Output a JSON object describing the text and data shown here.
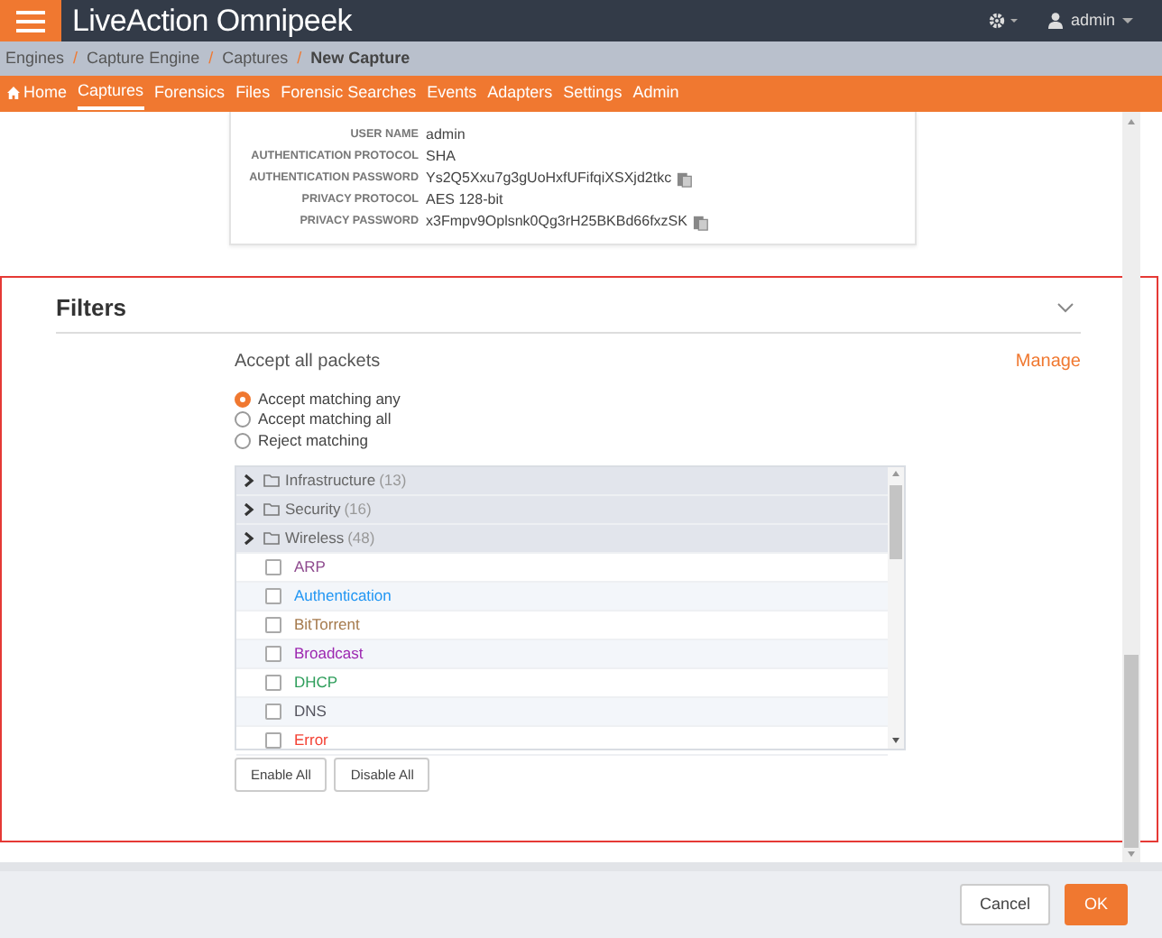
{
  "app": {
    "title": "LiveAction Omnipeek",
    "user": "admin"
  },
  "breadcrumb": [
    {
      "label": "Engines",
      "current": false
    },
    {
      "separator": "/",
      "label": "Capture Engine",
      "current": false
    },
    {
      "separator": "/",
      "label": "Captures",
      "current": false
    },
    {
      "separator": "/",
      "label": "New Capture",
      "current": true
    }
  ],
  "nav": [
    {
      "label": "Home",
      "selected": false,
      "icon": true
    },
    {
      "label": "Captures",
      "selected": true,
      "icon": false
    },
    {
      "label": "Forensics",
      "selected": false,
      "icon": false
    },
    {
      "label": "Files",
      "selected": false,
      "icon": false
    },
    {
      "label": "Forensic Searches",
      "selected": false,
      "icon": false
    },
    {
      "label": "Events",
      "selected": false,
      "icon": false
    },
    {
      "label": "Adapters",
      "selected": false,
      "icon": false
    },
    {
      "label": "Settings",
      "selected": false,
      "icon": false
    },
    {
      "label": "Admin",
      "selected": false,
      "icon": false
    }
  ],
  "snmp": [
    {
      "label": "USER NAME",
      "value": "admin",
      "copy": false
    },
    {
      "label": "AUTHENTICATION PROTOCOL",
      "value": "SHA",
      "copy": false
    },
    {
      "label": "AUTHENTICATION PASSWORD",
      "value": "Ys2Q5Xxu7g3gUoHxfUFifqiXSXjd2tkc",
      "copy": true
    },
    {
      "label": "PRIVACY PROTOCOL",
      "value": "AES 128-bit",
      "copy": false
    },
    {
      "label": "PRIVACY PASSWORD",
      "value": "x3Fmpv9Oplsnk0Qg3rH25BKBd66fxzSK",
      "copy": true
    }
  ],
  "filters": {
    "title": "Filters",
    "summary": "Accept all packets",
    "manage": "Manage",
    "modes": [
      {
        "label": "Accept matching any",
        "selected": true
      },
      {
        "label": "Accept matching all",
        "selected": false
      },
      {
        "label": "Reject matching",
        "selected": false
      }
    ],
    "items": [
      {
        "kind": "group",
        "label": "Infrastructure",
        "count": "(13)"
      },
      {
        "kind": "group",
        "label": "Security",
        "count": "(16)"
      },
      {
        "kind": "group",
        "label": "Wireless",
        "count": "(48)"
      },
      {
        "kind": "filter",
        "label": "ARP",
        "checked": false,
        "color": "#8e4a8e"
      },
      {
        "kind": "filter",
        "label": "Authentication",
        "checked": false,
        "color": "#2196f3"
      },
      {
        "kind": "filter",
        "label": "BitTorrent",
        "checked": false,
        "color": "#a57a4c"
      },
      {
        "kind": "filter",
        "label": "Broadcast",
        "checked": false,
        "color": "#9c27b0"
      },
      {
        "kind": "filter",
        "label": "DHCP",
        "checked": false,
        "color": "#2e9e5b"
      },
      {
        "kind": "filter",
        "label": "DNS",
        "checked": false,
        "color": "#55555f"
      },
      {
        "kind": "filter",
        "label": "Error",
        "checked": false,
        "color": "#f44336"
      }
    ],
    "buttons": [
      "Enable All",
      "Disable All"
    ]
  },
  "footer": {
    "buttons": [
      {
        "label": "Cancel",
        "primary": false
      },
      {
        "label": "OK",
        "primary": true
      }
    ]
  }
}
